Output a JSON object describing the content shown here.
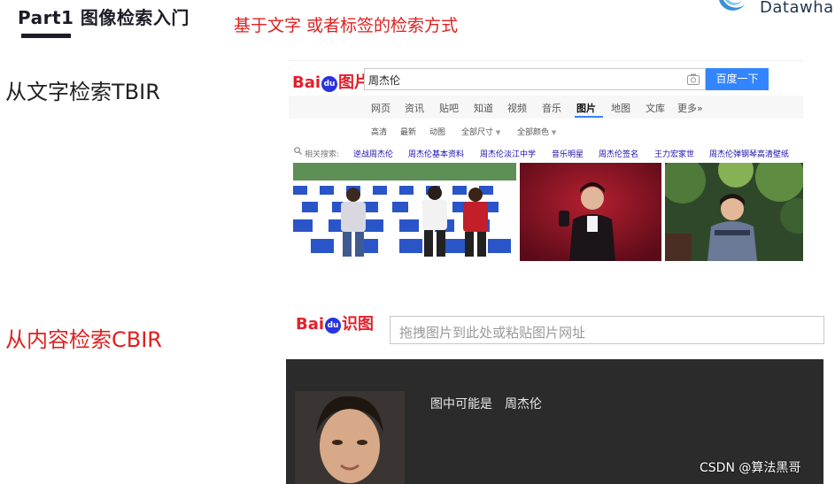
{
  "slide": {
    "title": "Part1 图像检索入门",
    "subtitle": "基于文字 或者标签的检索方式",
    "brand_text": "Datawhal",
    "label_text_search": "从文字检索TBIR",
    "label_content_search": "从内容检索CBIR",
    "watermark": "CSDN @算法黑哥"
  },
  "tb_search": {
    "logo_bai": "Bai",
    "logo_du": "du",
    "logo_suffix": "图片",
    "query": "周杰伦",
    "button_label": "百度一下",
    "nav_tabs": [
      "网页",
      "资讯",
      "贴吧",
      "知道",
      "视频",
      "音乐",
      "图片",
      "地图",
      "文库",
      "更多»"
    ],
    "active_tab": "图片",
    "filters": [
      "高清",
      "最新",
      "动图",
      "全部尺寸",
      "全部颜色"
    ],
    "related_label": "相关搜索:",
    "related_terms": [
      "逆战周杰伦",
      "周杰伦基本资料",
      "周杰伦淡江中学",
      "音乐明星",
      "周杰伦签名",
      "王力宏家世",
      "周杰伦弹钢琴高清壁纸"
    ]
  },
  "shitu": {
    "logo_bai": "Bai",
    "logo_du": "du",
    "logo_suffix": "识图",
    "placeholder": "拖拽图片到此处或粘贴图片网址",
    "result_label": "图中可能是",
    "result_name": "周杰伦"
  },
  "colors": {
    "accent_red": "#e02020",
    "baidu_blue": "#3385ff",
    "baidu_logo_blue": "#2932e1",
    "baidu_logo_red": "#e3202b",
    "title_dark": "#1c1c28",
    "result_bg": "#2b2b2b"
  },
  "icons": [
    "datawhale-logo-icon",
    "baidu-paw-icon",
    "camera-icon",
    "search-icon"
  ]
}
